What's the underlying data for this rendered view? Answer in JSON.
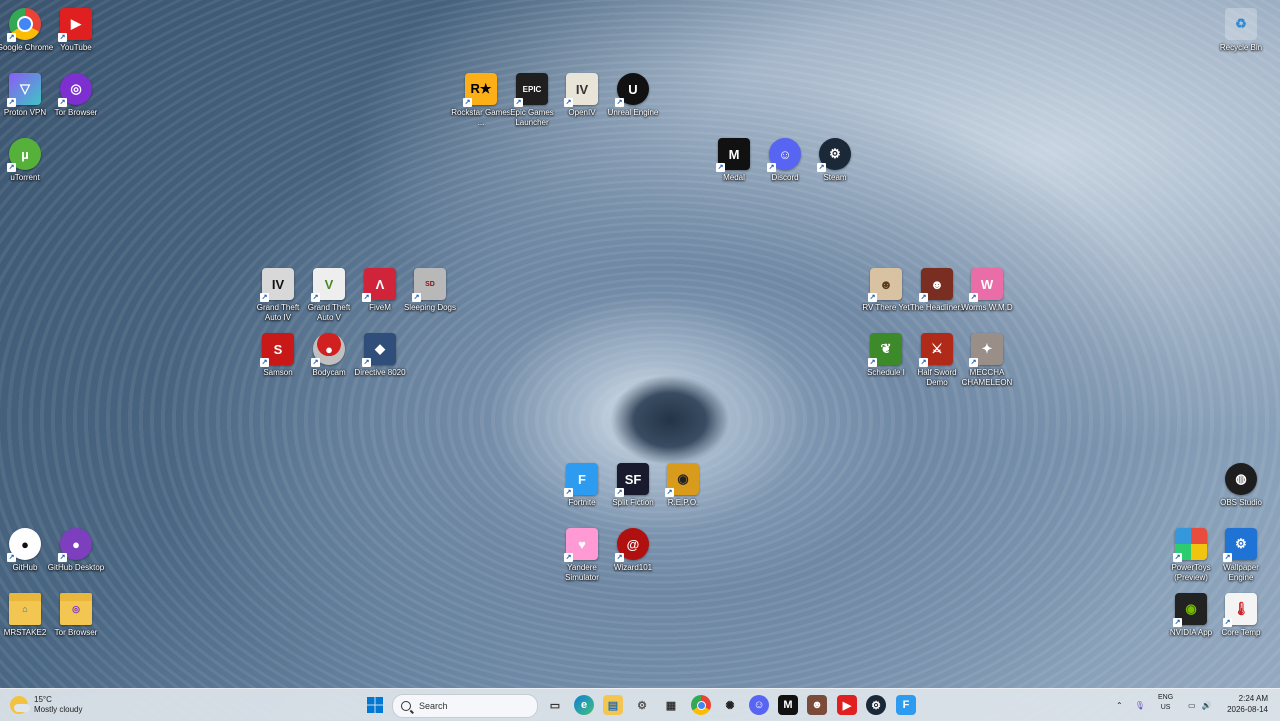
{
  "desktop": {
    "icons": {
      "chrome": {
        "label": "Google Chrome",
        "color": "#ffffff"
      },
      "youtube": {
        "label": "YouTube",
        "color": "#e02020"
      },
      "protonvpn": {
        "label": "Proton VPN",
        "color": "#8b5cf6"
      },
      "tor": {
        "label": "Tor Browser",
        "color": "#7d2fd0"
      },
      "utorrent": {
        "label": "uTorrent",
        "color": "#56b13a"
      },
      "rockstar": {
        "label": "Rockstar Games ...",
        "color": "#fcaf17"
      },
      "epic": {
        "label": "Epic Games Launcher",
        "color": "#1f1f1f"
      },
      "openiv": {
        "label": "OpenIV",
        "color": "#e8e4d8"
      },
      "unreal": {
        "label": "Unreal Engine",
        "color": "#111111"
      },
      "medal": {
        "label": "Medal",
        "color": "#111111"
      },
      "discord": {
        "label": "Discord",
        "color": "#5865f2"
      },
      "steam": {
        "label": "Steam",
        "color": "#1b2838"
      },
      "gta4": {
        "label": "Grand Theft Auto IV",
        "color": "#d8d8d8"
      },
      "gta5": {
        "label": "Grand Theft Auto V",
        "color": "#eeeeee"
      },
      "fivem": {
        "label": "FiveM",
        "color": "#d0243a"
      },
      "sleepingdogs": {
        "label": "Sleeping Dogs",
        "color": "#b8b8b8"
      },
      "samson": {
        "label": "Samson",
        "color": "#c81818"
      },
      "bodycam": {
        "label": "Bodycam",
        "color": "#c0c0c0"
      },
      "directive": {
        "label": "Directive 8020",
        "color": "#2f4f7a"
      },
      "rvthere": {
        "label": "RV There Yet",
        "color": "#d9c2a2"
      },
      "headliners": {
        "label": "The Headliners",
        "color": "#7a2e22"
      },
      "worms": {
        "label": "Worms W.M.D",
        "color": "#e96ea8"
      },
      "schedule1": {
        "label": "Schedule I",
        "color": "#3d8a2a"
      },
      "halfsword": {
        "label": "Half Sword Demo",
        "color": "#b02a1a"
      },
      "mecha": {
        "label": "MECCHA CHAMELEON",
        "color": "#9a8f88"
      },
      "fortnite": {
        "label": "Fortnite",
        "color": "#2d9cf0"
      },
      "splitfiction": {
        "label": "Split Fiction",
        "color": "#1a1a2e"
      },
      "repo": {
        "label": "R.E.P.O.",
        "color": "#d99b1c"
      },
      "yandere": {
        "label": "Yandere Simulator",
        "color": "#ff9ad5"
      },
      "wizard101": {
        "label": "Wizard101",
        "color": "#b01010"
      },
      "github": {
        "label": "GitHub",
        "color": "#ffffff"
      },
      "githubdesktop": {
        "label": "GitHub Desktop",
        "color": "#7e3fbf"
      },
      "mrstake": {
        "label": "MRSTAKE2",
        "color": "#f3c652"
      },
      "torfolder": {
        "label": "Tor Browser",
        "color": "#f3c652"
      },
      "recycle": {
        "label": "Recycle Bin",
        "color": "#8fbce6"
      },
      "obs": {
        "label": "OBS Studio",
        "color": "#1e1e1e"
      },
      "powertoys": {
        "label": "PowerToys (Preview)",
        "color": "#f0f0f0"
      },
      "wallpaper": {
        "label": "Wallpaper Engine",
        "color": "#1f73d4"
      },
      "nvidia": {
        "label": "NVIDIA App",
        "color": "#222222"
      },
      "coretemp": {
        "label": "Core Temp",
        "color": "#f4f4f4"
      }
    }
  },
  "taskbar": {
    "weather": {
      "temp": "15°C",
      "condition": "Mostly cloudy"
    },
    "search_label": "Search",
    "lang_top": "ENG",
    "lang_bottom": "US",
    "time": "2:24 AM",
    "date": "2026-08-14",
    "accent": "#0078d4"
  }
}
